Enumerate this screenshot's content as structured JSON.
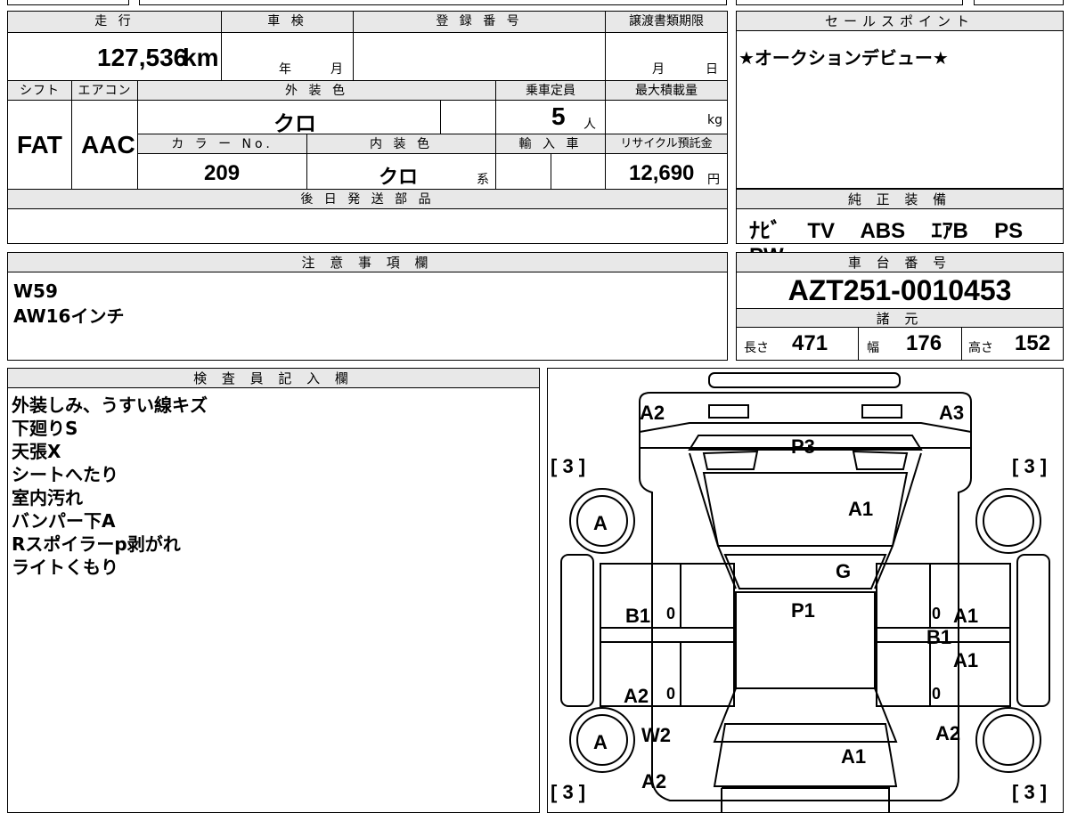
{
  "vehicle": {
    "mileage_label": "走 行",
    "mileage_value": "127,536",
    "mileage_unit": "km",
    "inspection_label": "車 検",
    "inspection_year_unit": "年",
    "inspection_month_unit": "月",
    "registration_label": "登 録 番 号",
    "transfer_label": "譲渡書類期限",
    "transfer_month_unit": "月",
    "transfer_day_unit": "日",
    "shift_label": "シフト",
    "shift_value": "FAT",
    "ac_label": "エアコン",
    "ac_value": "AAC",
    "exterior_label": "外 装 色",
    "exterior_value": "クロ",
    "capacity_label": "乗車定員",
    "capacity_value": "5",
    "capacity_unit": "人",
    "max_load_label": "最大積載量",
    "max_load_unit": "kg",
    "color_no_label": "カ ラ ー No.",
    "color_no_value": "209",
    "interior_label": "内 装 色",
    "interior_value": "クロ",
    "interior_suffix": "系",
    "import_label": "輸 入 車",
    "recycle_label": "リサイクル預託金",
    "recycle_value": "12,690",
    "recycle_unit": "円",
    "later_parts_label": "後 日 発 送 部 品"
  },
  "sales_point": {
    "label": "セールスポイント",
    "text": "★オークションデビュー★"
  },
  "equipment": {
    "label": "純 正 装 備",
    "items": [
      "ﾅﾋﾞ",
      "TV",
      "ABS",
      "ｴｱB",
      "PS",
      "PW"
    ]
  },
  "notes": {
    "label": "注 意 事 項 欄",
    "lines": [
      "W59",
      "AW16インチ"
    ]
  },
  "chassis": {
    "label": "車 台 番 号",
    "value": "AZT251-0010453",
    "spec_label": "諸 元",
    "length_label": "長さ",
    "length_value": "471",
    "width_label": "幅",
    "width_value": "176",
    "height_label": "高さ",
    "height_value": "152"
  },
  "inspector": {
    "label": "検 査 員 記 入 欄",
    "lines": [
      "外装しみ、うすい線キズ",
      "下廻りS",
      "天張X",
      "シートへたり",
      "室内汚れ",
      "バンパー下A",
      "Rスポイラーp剥がれ",
      "ライトくもり"
    ]
  },
  "diagram": {
    "marks": {
      "a2_front_left": "A2",
      "a3_front_right": "A3",
      "p3_dash": "P3",
      "tire_left_top": "[ 3 ]",
      "tire_right_top": "[ 3 ]",
      "a1_windshield": "A1",
      "a_wheel_front_left": "A",
      "g_roof": "G",
      "b1_left_door": "B1",
      "zero_1": "0",
      "p1_roof": "P1",
      "zero_2": "0",
      "a1_right_door": "A1",
      "b1_right": "B1",
      "a1_right_door_2": "A1",
      "a2_left_rear_door": "A2",
      "zero_3": "0",
      "zero_4": "0",
      "a_wheel_rear_left": "A",
      "w2_rear_left": "W2",
      "a2_rear_right": "A2",
      "a1_rear": "A1",
      "a2_rear_bumper": "A2",
      "tire_left_bottom": "[ 3 ]",
      "tire_right_bottom": "[ 3 ]"
    }
  }
}
